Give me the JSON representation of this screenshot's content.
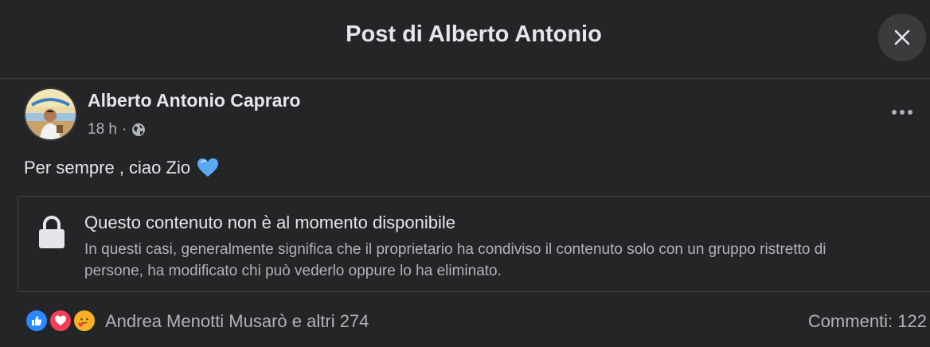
{
  "header": {
    "title": "Post di Alberto Antonio",
    "close_icon": "close-icon"
  },
  "post": {
    "author": "Alberto Antonio Capraro",
    "time": "18 h",
    "separator": "·",
    "audience_icon": "globe-icon",
    "text": "Per sempre , ciao Zio",
    "emoji": "💙",
    "more_icon": "more-horizontal-icon"
  },
  "unavailable": {
    "icon": "lock-icon",
    "title": "Questo contenuto non è al momento disponibile",
    "description": "In questi casi, generalmente significa che il proprietario ha condiviso il contenuto solo con un gruppo ristretto di persone, ha modificato chi può vederlo oppure lo ha eliminato."
  },
  "footer": {
    "reactions": [
      "like",
      "love",
      "care"
    ],
    "reaction_summary": "Andrea Menotti Musarò e altri 274",
    "comments": "Commenti: 122"
  },
  "colors": {
    "background": "#242526",
    "primary_text": "#e4e6eb",
    "secondary_text": "#b0b3b8",
    "divider": "#3e4042",
    "like": "#2d88ff",
    "love": "#f33e58",
    "care": "#f7b125"
  }
}
